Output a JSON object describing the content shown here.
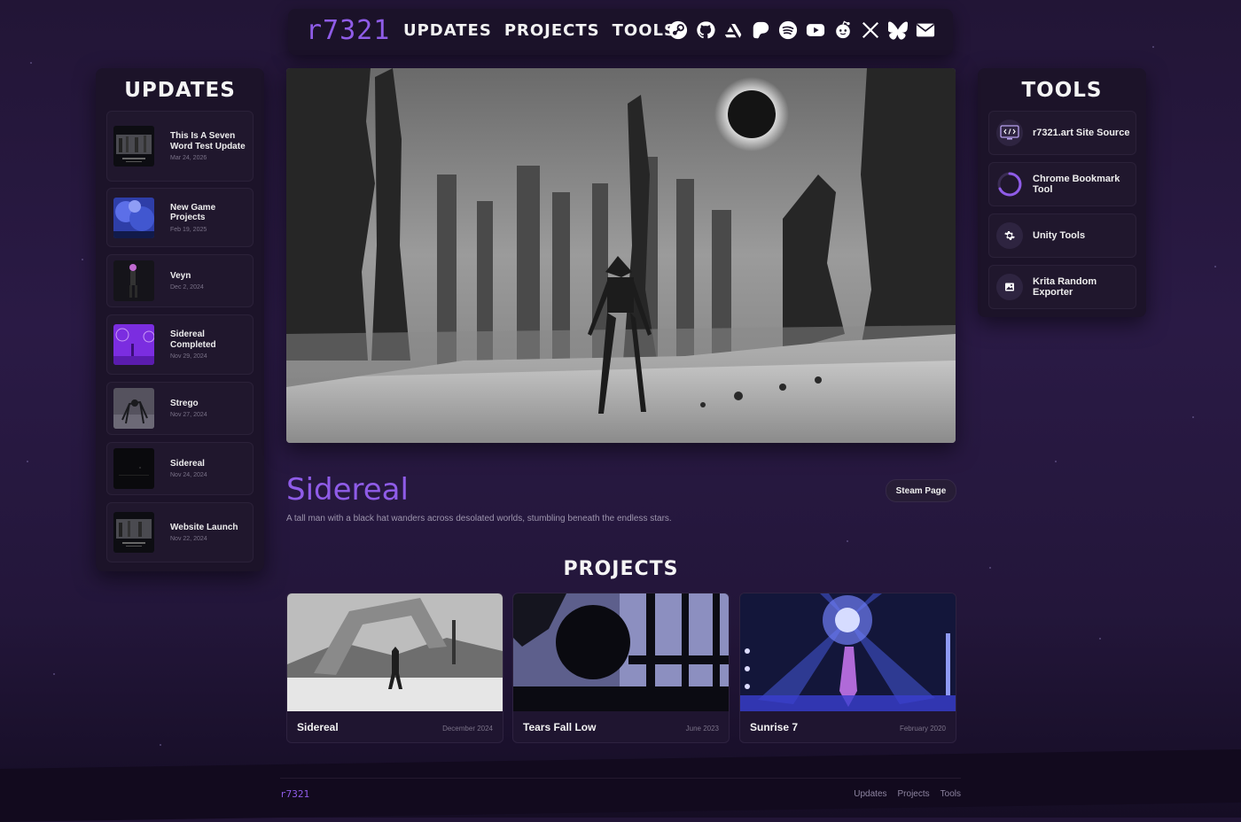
{
  "brand": "r7321",
  "nav": [
    "UPDATES",
    "PROJECTS",
    "TOOLS"
  ],
  "social_icons": [
    "steam-icon",
    "github-icon",
    "artstation-icon",
    "patreon-icon",
    "spotify-icon",
    "youtube-icon",
    "reddit-icon",
    "x-icon",
    "bluesky-icon",
    "mail-icon"
  ],
  "updates": {
    "title": "UPDATES",
    "items": [
      {
        "title": "This Is A Seven Word Test Update",
        "date": "Mar 24, 2026"
      },
      {
        "title": "New Game Projects",
        "date": "Feb 19, 2025"
      },
      {
        "title": "Veyn",
        "date": "Dec 2, 2024"
      },
      {
        "title": "Sidereal Completed",
        "date": "Nov 29, 2024"
      },
      {
        "title": "Strego",
        "date": "Nov 27, 2024"
      },
      {
        "title": "Sidereal",
        "date": "Nov 24, 2024"
      },
      {
        "title": "Website Launch",
        "date": "Nov 22, 2024"
      }
    ]
  },
  "tools": {
    "title": "TOOLS",
    "items": [
      {
        "label": "r7321.art Site Source",
        "icon": "code-icon"
      },
      {
        "label": "Chrome Bookmark Tool",
        "icon": "spinner-icon"
      },
      {
        "label": "Unity Tools",
        "icon": "gear-icon"
      },
      {
        "label": "Krita Random Exporter",
        "icon": "image-icon"
      }
    ]
  },
  "featured": {
    "title": "Sidereal",
    "button": "Steam Page",
    "description": "A tall man with a black hat wanders across desolated worlds, stumbling beneath the endless stars."
  },
  "projects": {
    "title": "PROJECTS",
    "items": [
      {
        "name": "Sidereal",
        "date": "December 2024"
      },
      {
        "name": "Tears Fall Low",
        "date": "June 2023"
      },
      {
        "name": "Sunrise 7",
        "date": "February 2020"
      }
    ]
  },
  "footer": {
    "brand": "r7321",
    "links": [
      "Updates",
      "Projects",
      "Tools"
    ]
  },
  "colors": {
    "accent": "#8f5ce8",
    "panel": "#1c1329",
    "background": "#2a1a45"
  }
}
